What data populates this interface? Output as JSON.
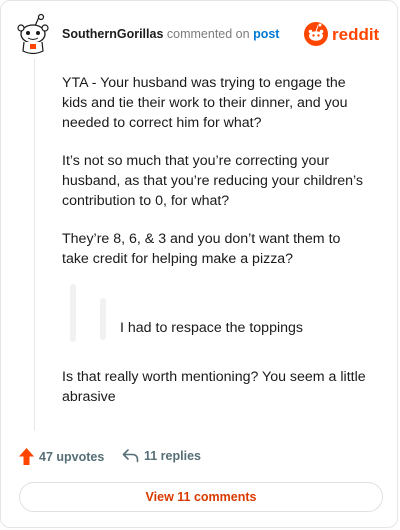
{
  "header": {
    "username": "SouthernGorillas",
    "commented_text": "commented on",
    "post_link": "post",
    "brand": "reddit"
  },
  "comment": {
    "paragraphs": [
      "YTA - Your husband was trying to engage the kids and tie their work to their dinner, and you needed to correct him for what?",
      "It’s not so much that you’re correcting your husband, as that you’re reducing your children’s contribution to 0, for what?",
      "They’re 8, 6, & 3 and you don’t want them to take credit for helping make a pizza?"
    ],
    "quote": "I had to respace the toppings",
    "closing": "Is that really worth mentioning? You seem a little abrasive"
  },
  "actions": {
    "upvotes": "47 upvotes",
    "replies": "11 replies"
  },
  "view_comments": "View 11 comments",
  "colors": {
    "brand": "#ff4500",
    "link": "#0079d3",
    "view_button": "#d93a00"
  }
}
